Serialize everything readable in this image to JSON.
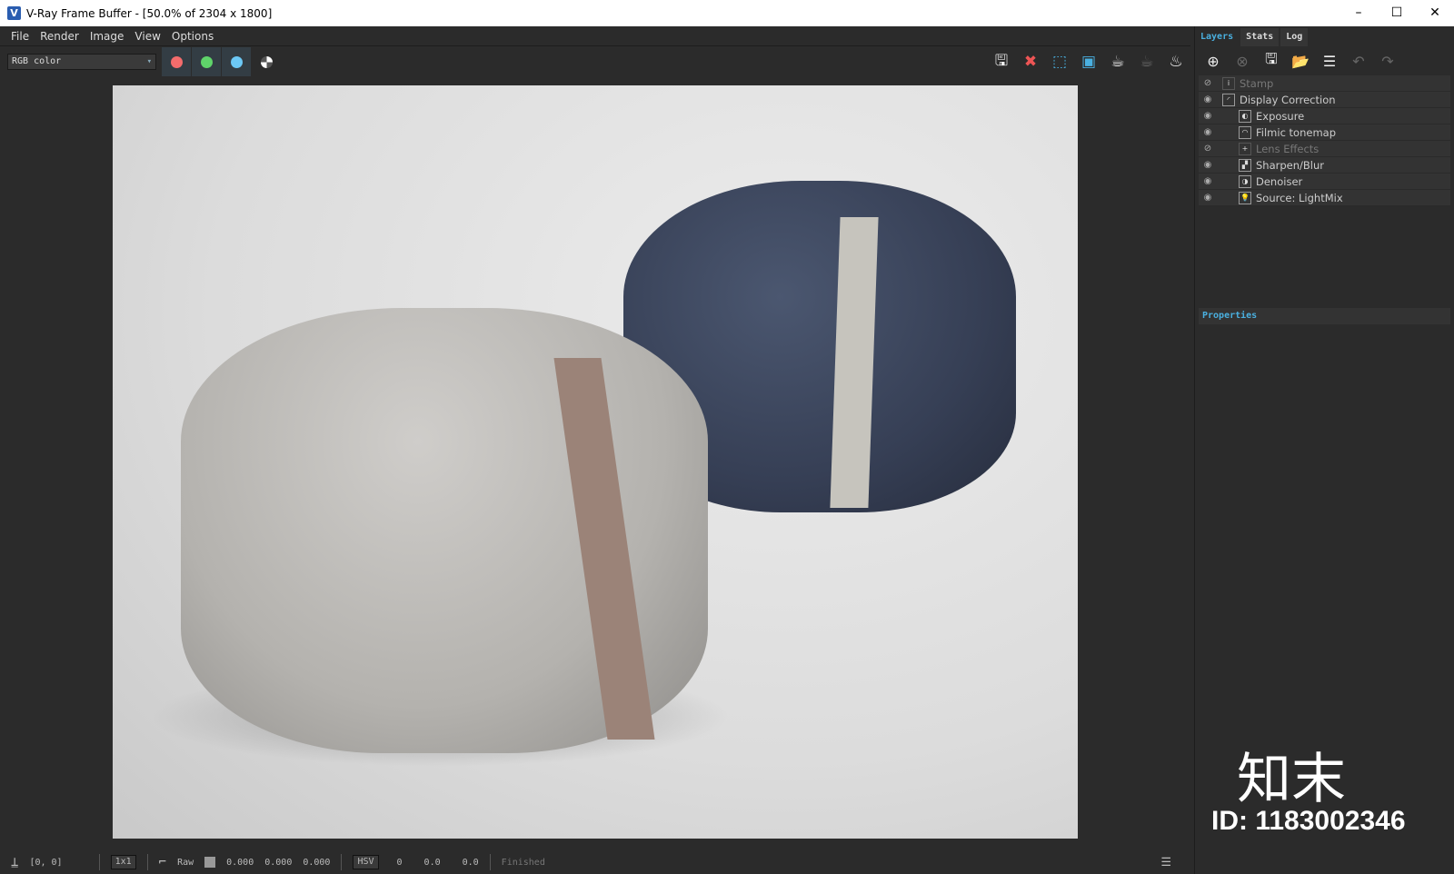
{
  "window": {
    "title": "V-Ray Frame Buffer - [50.0% of 2304 x 1800]",
    "minimize": "–",
    "maximize": "☐",
    "close": "✕"
  },
  "menu": [
    "File",
    "Render",
    "Image",
    "View",
    "Options"
  ],
  "toolbar": {
    "channel": "RGB color",
    "channel_colors": [
      "#f36c6c",
      "#5fd46a",
      "#6cc8f5"
    ],
    "right_icons": [
      "save-icon",
      "clear-icon",
      "region-icon",
      "lock-region-icon",
      "render-icon",
      "stop-icon",
      "teapot-icon"
    ]
  },
  "panel": {
    "tabs": [
      "Layers",
      "Stats",
      "Log"
    ],
    "layers": [
      {
        "name": "Stamp",
        "enabled": false,
        "indent": 0
      },
      {
        "name": "Display Correction",
        "enabled": true,
        "indent": 0
      },
      {
        "name": "Exposure",
        "enabled": true,
        "indent": 1
      },
      {
        "name": "Filmic tonemap",
        "enabled": true,
        "indent": 1
      },
      {
        "name": "Lens Effects",
        "enabled": false,
        "indent": 1
      },
      {
        "name": "Sharpen/Blur",
        "enabled": true,
        "indent": 1
      },
      {
        "name": "Denoiser",
        "enabled": true,
        "indent": 1
      },
      {
        "name": "Source: LightMix",
        "enabled": true,
        "indent": 1
      }
    ],
    "properties": "Properties"
  },
  "status": {
    "coords": "[0, 0]",
    "sample": "1x1",
    "raw": "Raw",
    "r": "0.000",
    "g": "0.000",
    "b": "0.000",
    "colorspace": "HSV",
    "h": "0",
    "s": "0.0",
    "v": "0.0",
    "state": "Finished"
  },
  "watermark": {
    "text": "知末",
    "id": "ID: 1183002346"
  }
}
